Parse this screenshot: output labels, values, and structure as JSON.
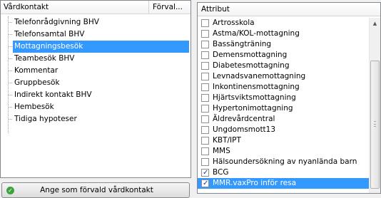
{
  "left": {
    "header": {
      "col1": "Vårdkontakt",
      "col2": "Förval..."
    },
    "items": [
      {
        "label": "Telefonrådgivning BHV",
        "selected": false
      },
      {
        "label": "Telefonsamtal BHV",
        "selected": false
      },
      {
        "label": "Mottagningsbesök",
        "selected": true
      },
      {
        "label": "Teambesök BHV",
        "selected": false
      },
      {
        "label": "Kommentar",
        "selected": false
      },
      {
        "label": "Gruppbesök",
        "selected": false
      },
      {
        "label": "Indirekt kontakt BHV",
        "selected": false
      },
      {
        "label": "Hembesök",
        "selected": false
      },
      {
        "label": "Tidiga hypoteser",
        "selected": false
      }
    ]
  },
  "button": {
    "label": "Ange som förvald vårdkontakt",
    "icon": "check-circle-icon",
    "icon_color": "#3ea33e"
  },
  "right": {
    "header": "Attribut",
    "items": [
      {
        "label": "Artrosskola",
        "checked": false,
        "selected": false
      },
      {
        "label": "Astma/KOL-mottagning",
        "checked": false,
        "selected": false
      },
      {
        "label": "Bassängträning",
        "checked": false,
        "selected": false
      },
      {
        "label": "Demensmottagning",
        "checked": false,
        "selected": false
      },
      {
        "label": "Diabetesmottagning",
        "checked": false,
        "selected": false
      },
      {
        "label": "Levnadsvanemottagning",
        "checked": false,
        "selected": false
      },
      {
        "label": "Inkontinensmottagning",
        "checked": false,
        "selected": false
      },
      {
        "label": "Hjärtsviktsmottagning",
        "checked": false,
        "selected": false
      },
      {
        "label": "Hypertonimottagning",
        "checked": false,
        "selected": false
      },
      {
        "label": "Äldrevårdcentral",
        "checked": false,
        "selected": false
      },
      {
        "label": "Ungdomsmott13",
        "checked": false,
        "selected": false
      },
      {
        "label": "KBT/IPT",
        "checked": false,
        "selected": false
      },
      {
        "label": "MMS",
        "checked": false,
        "selected": false
      },
      {
        "label": "Hälsoundersökning av nyanlända barn",
        "checked": false,
        "selected": false
      },
      {
        "label": "BCG",
        "checked": true,
        "selected": false
      },
      {
        "label": "MMR.vaxPro inför resa",
        "checked": true,
        "selected": true
      }
    ]
  },
  "colors": {
    "selection": "#3399ff",
    "border": "#828790"
  }
}
